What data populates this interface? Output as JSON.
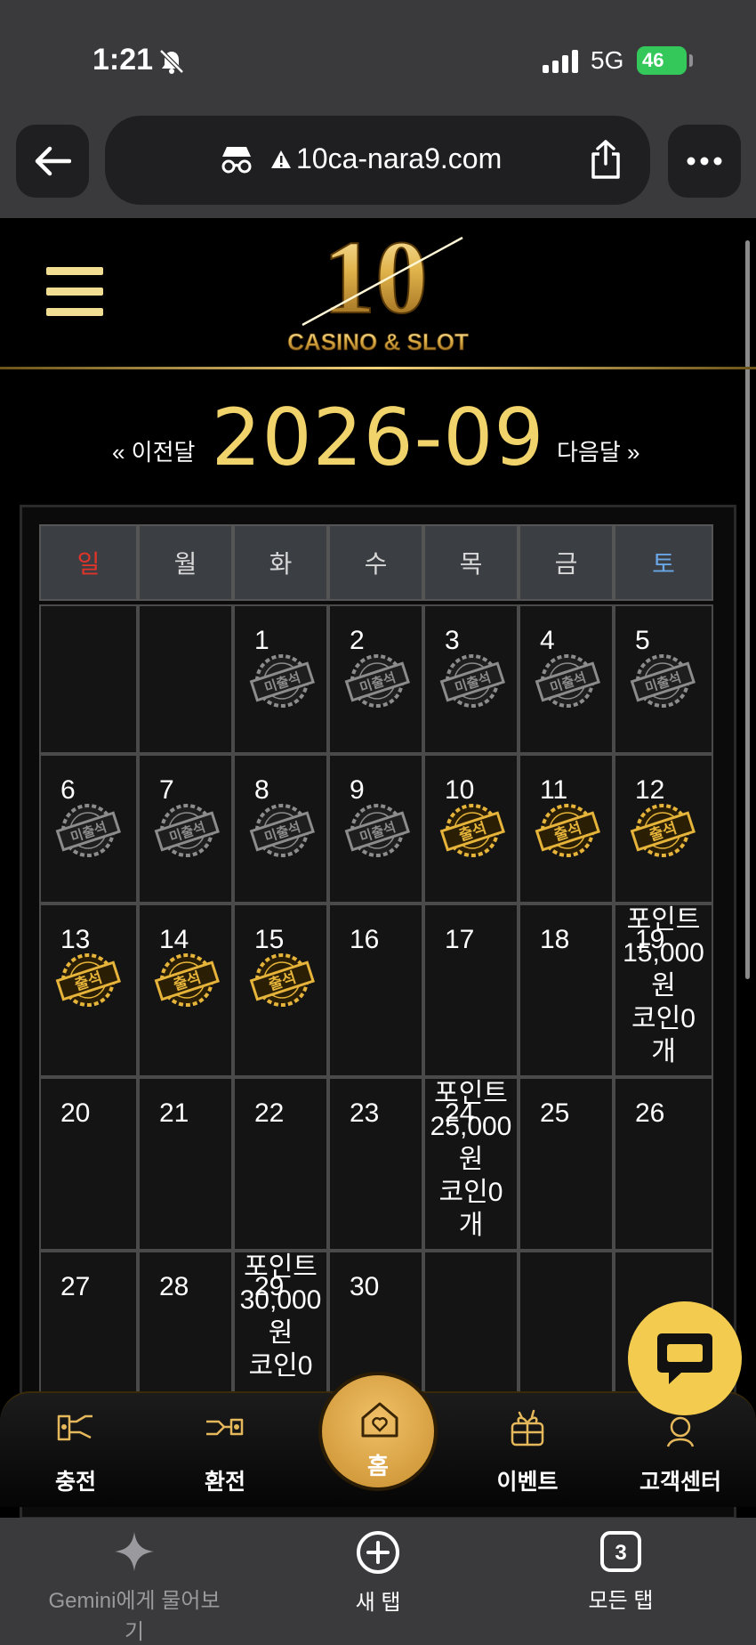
{
  "status_bar": {
    "time": "1:21",
    "network": "5G",
    "battery": "46"
  },
  "browser": {
    "url": "10ca-nara9.com"
  },
  "site": {
    "logo_number": "10",
    "logo_text": "CASINO & SLOT"
  },
  "calendar": {
    "prev_label": "« 이전달",
    "month": "2026-09",
    "next_label": "다음달 »",
    "weekdays": [
      "일",
      "월",
      "화",
      "수",
      "목",
      "금",
      "토"
    ],
    "weekday_colors": [
      "#e0342a",
      "#d8d8d8",
      "#d8d8d8",
      "#d8d8d8",
      "#d8d8d8",
      "#d8d8d8",
      "#6aa6e6"
    ],
    "stamp_labels": {
      "absent": "미출석",
      "present": "출석"
    },
    "weeks": [
      [
        {
          "day": ""
        },
        {
          "day": ""
        },
        {
          "day": "1",
          "stamp": "absent"
        },
        {
          "day": "2",
          "stamp": "absent"
        },
        {
          "day": "3",
          "stamp": "absent"
        },
        {
          "day": "4",
          "stamp": "absent"
        },
        {
          "day": "5",
          "stamp": "absent"
        }
      ],
      [
        {
          "day": "6",
          "stamp": "absent"
        },
        {
          "day": "7",
          "stamp": "absent"
        },
        {
          "day": "8",
          "stamp": "absent"
        },
        {
          "day": "9",
          "stamp": "absent"
        },
        {
          "day": "10",
          "stamp": "present"
        },
        {
          "day": "11",
          "stamp": "present"
        },
        {
          "day": "12",
          "stamp": "present"
        }
      ],
      [
        {
          "day": "13",
          "stamp": "present"
        },
        {
          "day": "14",
          "stamp": "present"
        },
        {
          "day": "15",
          "stamp": "present"
        },
        {
          "day": "16"
        },
        {
          "day": "17"
        },
        {
          "day": "18"
        },
        {
          "day": "19",
          "reward": [
            "포인트",
            "15,000",
            "원",
            "코인0",
            "개"
          ]
        }
      ],
      [
        {
          "day": "20"
        },
        {
          "day": "21"
        },
        {
          "day": "22"
        },
        {
          "day": "23"
        },
        {
          "day": "24",
          "reward": [
            "포인트",
            "25,000",
            "원",
            "코인0",
            "개"
          ]
        },
        {
          "day": "25"
        },
        {
          "day": "26"
        }
      ],
      [
        {
          "day": "27"
        },
        {
          "day": "28"
        },
        {
          "day": "29",
          "reward": [
            "포인트",
            "30,000",
            "원",
            "코인0"
          ]
        },
        {
          "day": "30"
        },
        {
          "day": ""
        },
        {
          "day": ""
        },
        {
          "day": ""
        }
      ]
    ]
  },
  "site_nav": {
    "charge": "충전",
    "exchange": "환전",
    "home": "홈",
    "event": "이벤트",
    "support": "고객센터"
  },
  "browser_toolbar": {
    "gemini": "Gemini에게 물어보기",
    "new_tab": "새 탭",
    "all_tabs": "모든 탭",
    "tab_count": "3"
  },
  "colors": {
    "gold": "#f1d36c",
    "chat_button": "#f3cb4e",
    "home_button": "#e0aa4c"
  }
}
